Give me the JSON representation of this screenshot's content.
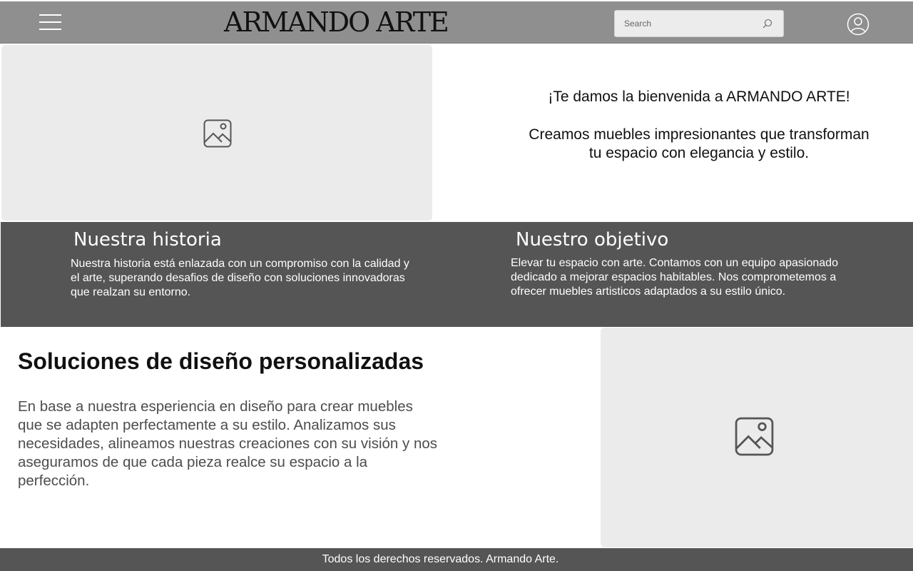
{
  "header": {
    "logo_text": "ARMANDO ARTE",
    "search_placeholder": "Search",
    "menu_icon": "hamburger-menu-icon",
    "search_icon": "search-icon",
    "account_icon": "user-account-icon"
  },
  "hero": {
    "image_icon": "image-placeholder-icon",
    "welcome_title": "¡Te damos la bienvenida a ARMANDO ARTE!",
    "welcome_subtitle": "Creamos muebles impresionantes que transforman tu espacio con elegancia y estilo."
  },
  "about": {
    "history_title": "Nuestra historia",
    "history_text": "Nuestra historia está enlazada con un compromiso con la calidad y el arte, superando desafios de diseño con soluciones innovadoras que realzan su entorno.",
    "objective_title": "Nuestro objetivo",
    "objective_text": "Elevar tu espacio con arte. Contamos con un equipo apasionado dedicado a mejorar espacios habitables. Nos comprometemos a ofrecer muebles artisticos adaptados a su estilo único."
  },
  "solutions": {
    "title": "Soluciones de diseño personalizadas",
    "text": "En base a nuestra esperiencia en diseño para crear muebles que se adapten perfectamente a su estilo. Analizamos sus necesidades, alineamos nuestras creaciones con su visión y nos aseguramos de que cada pieza realce su espacio a la perfección.",
    "image_icon": "image-placeholder-icon"
  },
  "footer": {
    "text": "Todos los derechos reservados. Armando Arte."
  },
  "colors": {
    "header_bg": "#8f8f8f",
    "band_bg": "#555555",
    "placeholder_bg": "#ebebeb"
  }
}
